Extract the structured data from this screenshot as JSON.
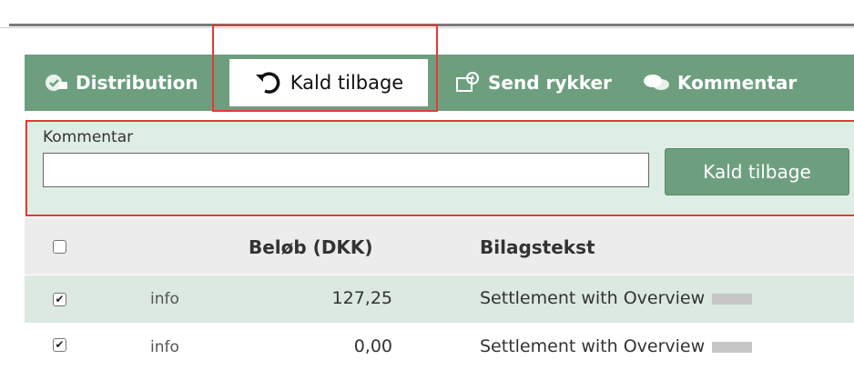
{
  "toolbar": {
    "distribution": "Distribution",
    "kald_tilbage": "Kald tilbage",
    "send_rykker": "Send rykker",
    "kommentar": "Kommentar"
  },
  "panel": {
    "label": "Kommentar",
    "input_value": "",
    "button": "Kald tilbage"
  },
  "table": {
    "columns": [
      "",
      "",
      "Beløb (DKK)",
      "Bilagstekst"
    ],
    "rows": [
      {
        "checked": true,
        "info": "info",
        "amount": "127,25",
        "text": "Settlement with Overview"
      },
      {
        "checked": true,
        "info": "info",
        "amount": "0,00",
        "text": "Settlement with Overview"
      }
    ]
  },
  "colors": {
    "accent_green": "#6d9f7f",
    "panel_bg": "#dfeee4",
    "highlight_red": "#e53935"
  }
}
